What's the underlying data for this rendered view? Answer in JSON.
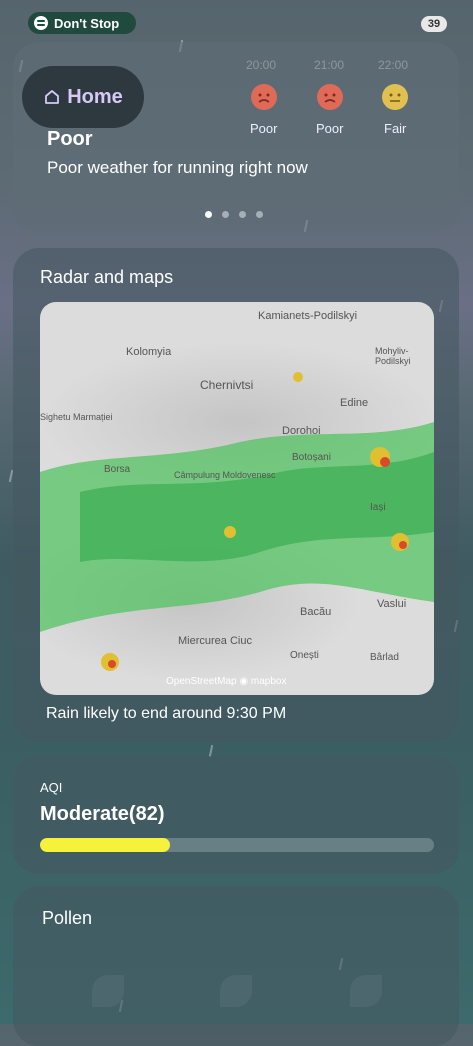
{
  "status_bar": {
    "music_label": "Don't Stop",
    "music_icon": "spotify-icon",
    "battery": "39"
  },
  "nav": {
    "home_label": "Home",
    "home_icon": "home-icon"
  },
  "forecast": {
    "hours": [
      {
        "time": "20:00",
        "rating": "Poor"
      },
      {
        "time": "21:00",
        "rating": "Poor"
      },
      {
        "time": "22:00",
        "rating": "Fair"
      }
    ],
    "title": "Poor",
    "description": "Poor weather for running right now",
    "pages": 4,
    "active_page": 1
  },
  "radar": {
    "title": "Radar and maps",
    "places": [
      "Kamianets-Podilskyi",
      "Kolomyia",
      "Mohyliv-Podilskyi",
      "Chernivtsi",
      "Edine",
      "Dorohoi",
      "Borsa",
      "Câmpulung Moldovenesc",
      "Botoșani",
      "Iași",
      "Vaslui",
      "Bacău",
      "Miercurea Ciuc",
      "Onești",
      "Bârlad",
      "Sighetu Marmației"
    ],
    "credit_osm": "OpenStreetMap",
    "credit_mapbox": "mapbox",
    "note": "Rain likely to end around 9:30 PM"
  },
  "aqi": {
    "label": "AQI",
    "value": "Moderate(82)",
    "level": 0.33,
    "color": "#f6f23c"
  },
  "pollen": {
    "title": "Pollen"
  }
}
